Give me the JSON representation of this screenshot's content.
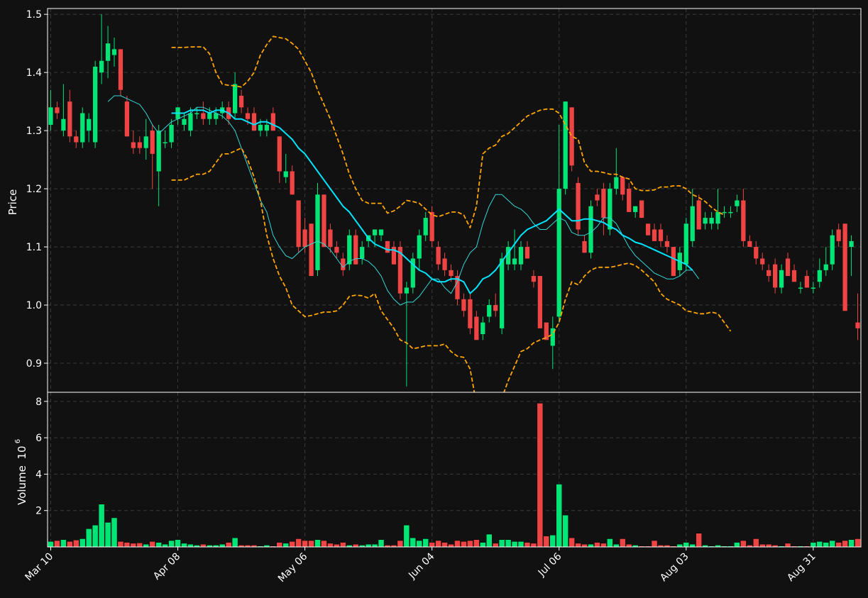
{
  "chart_data": {
    "type": "candlestick",
    "colors": {
      "background": "#111111",
      "up": "#00e676",
      "down": "#ef4444",
      "sma_long": "#00e5ff",
      "sma_short": "#33d6d6",
      "bands": "#ffa500",
      "grid": "#3a3a3a",
      "axes": "#ffffff"
    },
    "grid": true,
    "price_panel": {
      "ylabel": "Price",
      "ylim": [
        0.85,
        1.51
      ],
      "yticks": [
        0.9,
        1.0,
        1.1,
        1.2,
        1.3,
        1.4,
        1.5
      ],
      "ytick_labels": [
        "0.9",
        "1.0",
        "1.1",
        "1.2",
        "1.3",
        "1.4",
        "1.5"
      ]
    },
    "volume_panel": {
      "ylabel": "Volume",
      "scale_label": "10",
      "scale_exponent": "6",
      "ylim": [
        0,
        8.5
      ],
      "yticks": [
        2,
        4,
        6,
        8
      ],
      "ytick_labels": [
        "2",
        "4",
        "6",
        "8"
      ]
    },
    "xticks": [
      {
        "index": 0,
        "label": "Mar 10"
      },
      {
        "index": 20,
        "label": "Apr 08"
      },
      {
        "index": 40,
        "label": "May 06"
      },
      {
        "index": 60,
        "label": "Jun 04"
      },
      {
        "index": 80,
        "label": "Jul 06"
      },
      {
        "index": 100,
        "label": "Aug 03"
      },
      {
        "index": 120,
        "label": "Aug 31"
      }
    ],
    "candles": [
      [
        1.31,
        1.37,
        1.3,
        1.34,
        0.3
      ],
      [
        1.34,
        1.35,
        1.32,
        1.33,
        0.35
      ],
      [
        1.3,
        1.38,
        1.29,
        1.32,
        0.4
      ],
      [
        1.35,
        1.37,
        1.28,
        1.29,
        0.3
      ],
      [
        1.29,
        1.3,
        1.27,
        1.28,
        0.38
      ],
      [
        1.28,
        1.34,
        1.27,
        1.33,
        0.45
      ],
      [
        1.3,
        1.33,
        1.28,
        1.32,
        1.0
      ],
      [
        1.28,
        1.42,
        1.27,
        1.41,
        1.2
      ],
      [
        1.4,
        1.5,
        1.38,
        1.42,
        2.35
      ],
      [
        1.42,
        1.48,
        1.39,
        1.45,
        1.35
      ],
      [
        1.43,
        1.46,
        1.41,
        1.44,
        1.6
      ],
      [
        1.44,
        1.44,
        1.36,
        1.37,
        0.3
      ],
      [
        1.35,
        1.36,
        1.29,
        1.29,
        0.25
      ],
      [
        1.28,
        1.3,
        1.26,
        1.27,
        0.2
      ],
      [
        1.28,
        1.29,
        1.26,
        1.27,
        0.22
      ],
      [
        1.27,
        1.32,
        1.25,
        1.29,
        0.15
      ],
      [
        1.3,
        1.31,
        1.2,
        1.26,
        0.3
      ],
      [
        1.23,
        1.31,
        1.17,
        1.3,
        0.25
      ],
      [
        1.28,
        1.3,
        1.27,
        1.28,
        0.15
      ],
      [
        1.28,
        1.32,
        1.27,
        1.31,
        0.35
      ],
      [
        1.32,
        1.34,
        1.31,
        1.34,
        0.4
      ],
      [
        1.31,
        1.33,
        1.3,
        1.32,
        0.2
      ],
      [
        1.3,
        1.34,
        1.29,
        1.33,
        0.15
      ],
      [
        1.33,
        1.34,
        1.32,
        1.33,
        0.1
      ],
      [
        1.33,
        1.35,
        1.31,
        1.32,
        0.15
      ],
      [
        1.32,
        1.34,
        1.31,
        1.33,
        0.1
      ],
      [
        1.32,
        1.34,
        1.31,
        1.33,
        0.1
      ],
      [
        1.33,
        1.35,
        1.32,
        1.34,
        0.15
      ],
      [
        1.34,
        1.35,
        1.31,
        1.32,
        0.25
      ],
      [
        1.33,
        1.4,
        1.32,
        1.38,
        0.5
      ],
      [
        1.36,
        1.37,
        1.33,
        1.34,
        0.1
      ],
      [
        1.33,
        1.34,
        1.31,
        1.32,
        0.1
      ],
      [
        1.33,
        1.34,
        1.3,
        1.3,
        0.1
      ],
      [
        1.3,
        1.32,
        1.29,
        1.31,
        0.05
      ],
      [
        1.3,
        1.32,
        1.29,
        1.31,
        0.1
      ],
      [
        1.33,
        1.34,
        1.3,
        1.3,
        0.05
      ],
      [
        1.29,
        1.29,
        1.21,
        1.23,
        0.25
      ],
      [
        1.22,
        1.26,
        1.21,
        1.23,
        0.2
      ],
      [
        1.23,
        1.24,
        1.19,
        1.19,
        0.3
      ],
      [
        1.18,
        1.18,
        1.09,
        1.1,
        0.45
      ],
      [
        1.13,
        1.15,
        1.09,
        1.1,
        0.35
      ],
      [
        1.14,
        1.14,
        1.05,
        1.05,
        0.35
      ],
      [
        1.06,
        1.21,
        1.05,
        1.19,
        0.4
      ],
      [
        1.19,
        1.19,
        1.1,
        1.1,
        0.35
      ],
      [
        1.13,
        1.14,
        1.09,
        1.1,
        0.2
      ],
      [
        1.1,
        1.11,
        1.08,
        1.09,
        0.15
      ],
      [
        1.08,
        1.09,
        1.05,
        1.06,
        0.25
      ],
      [
        1.07,
        1.13,
        1.06,
        1.12,
        0.1
      ],
      [
        1.12,
        1.13,
        1.07,
        1.07,
        0.15
      ],
      [
        1.08,
        1.11,
        1.07,
        1.1,
        0.1
      ],
      [
        1.11,
        1.12,
        1.1,
        1.12,
        0.15
      ],
      [
        1.12,
        1.13,
        1.1,
        1.13,
        0.15
      ],
      [
        1.12,
        1.13,
        1.11,
        1.13,
        0.4
      ],
      [
        1.11,
        1.11,
        1.09,
        1.09,
        0.1
      ],
      [
        1.1,
        1.11,
        1.07,
        1.07,
        0.1
      ],
      [
        1.1,
        1.11,
        1.01,
        1.02,
        0.35
      ],
      [
        1.02,
        1.04,
        0.86,
        1.03,
        1.2
      ],
      [
        1.03,
        1.09,
        1.02,
        1.08,
        0.5
      ],
      [
        1.08,
        1.13,
        1.06,
        1.12,
        0.35
      ],
      [
        1.12,
        1.16,
        1.11,
        1.15,
        0.45
      ],
      [
        1.16,
        1.17,
        1.1,
        1.11,
        0.25
      ],
      [
        1.1,
        1.11,
        1.06,
        1.07,
        0.35
      ],
      [
        1.08,
        1.09,
        1.05,
        1.06,
        0.25
      ],
      [
        1.06,
        1.07,
        1.04,
        1.05,
        0.15
      ],
      [
        1.05,
        1.06,
        1.0,
        1.01,
        0.35
      ],
      [
        1.01,
        1.02,
        0.98,
        0.99,
        0.3
      ],
      [
        1.01,
        1.02,
        0.95,
        0.96,
        0.35
      ],
      [
        0.98,
        0.99,
        0.94,
        0.94,
        0.4
      ],
      [
        0.95,
        0.98,
        0.94,
        0.97,
        0.25
      ],
      [
        0.98,
        1.01,
        0.97,
        1.0,
        0.7
      ],
      [
        1.0,
        1.02,
        0.98,
        0.99,
        0.2
      ],
      [
        0.96,
        1.09,
        0.95,
        1.08,
        0.4
      ],
      [
        1.07,
        1.11,
        1.06,
        1.1,
        0.4
      ],
      [
        1.07,
        1.13,
        1.06,
        1.08,
        0.3
      ],
      [
        1.07,
        1.11,
        1.06,
        1.1,
        0.3
      ],
      [
        1.1,
        1.11,
        1.08,
        1.08,
        0.25
      ],
      [
        1.05,
        1.06,
        1.03,
        1.04,
        0.2
      ],
      [
        1.05,
        1.05,
        0.96,
        0.96,
        7.9
      ],
      [
        0.97,
        0.97,
        0.94,
        0.94,
        0.6
      ],
      [
        0.93,
        0.98,
        0.89,
        0.96,
        0.65
      ],
      [
        0.98,
        1.31,
        0.97,
        1.2,
        3.45
      ],
      [
        1.2,
        1.35,
        1.19,
        1.35,
        1.75
      ],
      [
        1.34,
        1.34,
        1.23,
        1.24,
        0.5
      ],
      [
        1.21,
        1.22,
        1.12,
        1.13,
        0.2
      ],
      [
        1.11,
        1.12,
        1.09,
        1.09,
        0.15
      ],
      [
        1.09,
        1.18,
        1.08,
        1.17,
        0.15
      ],
      [
        1.19,
        1.2,
        1.17,
        1.18,
        0.25
      ],
      [
        1.2,
        1.21,
        1.12,
        1.15,
        0.2
      ],
      [
        1.13,
        1.21,
        1.12,
        1.2,
        0.45
      ],
      [
        1.2,
        1.27,
        1.19,
        1.22,
        0.15
      ],
      [
        1.22,
        1.22,
        1.18,
        1.19,
        0.45
      ],
      [
        1.2,
        1.21,
        1.16,
        1.16,
        0.15
      ],
      [
        1.16,
        1.17,
        1.15,
        1.17,
        0.1
      ],
      [
        1.18,
        1.18,
        1.15,
        1.15,
        0.05
      ],
      [
        1.14,
        1.14,
        1.12,
        1.12,
        0.05
      ],
      [
        1.13,
        1.14,
        1.11,
        1.11,
        0.35
      ],
      [
        1.13,
        1.14,
        1.1,
        1.11,
        0.1
      ],
      [
        1.11,
        1.12,
        1.09,
        1.1,
        0.1
      ],
      [
        1.1,
        1.1,
        1.05,
        1.05,
        0.05
      ],
      [
        1.06,
        1.1,
        1.05,
        1.09,
        0.15
      ],
      [
        1.07,
        1.15,
        1.06,
        1.14,
        0.25
      ],
      [
        1.11,
        1.2,
        1.1,
        1.17,
        0.15
      ],
      [
        1.18,
        1.19,
        1.13,
        1.13,
        0.75
      ],
      [
        1.14,
        1.16,
        1.13,
        1.15,
        0.1
      ],
      [
        1.14,
        1.16,
        1.13,
        1.15,
        0.05
      ],
      [
        1.14,
        1.2,
        1.13,
        1.16,
        0.1
      ],
      [
        1.16,
        1.17,
        1.15,
        1.16,
        0.05
      ],
      [
        1.16,
        1.17,
        1.15,
        1.16,
        0.05
      ],
      [
        1.17,
        1.19,
        1.16,
        1.18,
        0.25
      ],
      [
        1.18,
        1.2,
        1.1,
        1.11,
        0.35
      ],
      [
        1.11,
        1.12,
        1.1,
        1.1,
        0.1
      ],
      [
        1.1,
        1.11,
        1.07,
        1.08,
        0.45
      ],
      [
        1.08,
        1.09,
        1.06,
        1.07,
        0.15
      ],
      [
        1.06,
        1.07,
        1.04,
        1.05,
        0.15
      ],
      [
        1.07,
        1.08,
        1.02,
        1.03,
        0.1
      ],
      [
        1.03,
        1.07,
        1.02,
        1.06,
        0.05
      ],
      [
        1.08,
        1.09,
        1.05,
        1.05,
        0.2
      ],
      [
        1.06,
        1.07,
        1.04,
        1.04,
        0.05
      ],
      [
        1.03,
        1.04,
        1.02,
        1.03,
        0.05
      ],
      [
        1.05,
        1.06,
        1.03,
        1.03,
        0.05
      ],
      [
        1.03,
        1.04,
        1.02,
        1.03,
        0.25
      ],
      [
        1.04,
        1.08,
        1.03,
        1.06,
        0.3
      ],
      [
        1.06,
        1.1,
        1.05,
        1.07,
        0.25
      ],
      [
        1.07,
        1.13,
        1.06,
        1.12,
        0.35
      ],
      [
        1.13,
        1.14,
        1.1,
        1.11,
        0.25
      ],
      [
        1.14,
        1.14,
        0.99,
        0.99,
        0.35
      ],
      [
        1.1,
        1.12,
        1.05,
        1.11,
        0.4
      ],
      [
        0.97,
        1.02,
        0.94,
        0.96,
        0.45
      ]
    ],
    "sma_long": {
      "start": 19,
      "values": [
        1.33,
        1.33,
        1.33,
        1.335,
        1.335,
        1.335,
        1.33,
        1.335,
        1.335,
        1.33,
        1.32,
        1.32,
        1.315,
        1.31,
        1.315,
        1.315,
        1.31,
        1.305,
        1.295,
        1.285,
        1.27,
        1.26,
        1.245,
        1.23,
        1.215,
        1.2,
        1.185,
        1.17,
        1.16,
        1.145,
        1.13,
        1.115,
        1.105,
        1.1,
        1.095,
        1.095,
        1.09,
        1.08,
        1.07,
        1.06,
        1.055,
        1.045,
        1.04,
        1.04,
        1.045,
        1.045,
        1.04,
        1.02,
        1.03,
        1.045,
        1.05,
        1.06,
        1.075,
        1.09,
        1.105,
        1.12,
        1.13,
        1.135,
        1.14,
        1.145,
        1.155,
        1.165,
        1.155,
        1.145,
        1.145,
        1.148,
        1.148,
        1.145,
        1.142,
        1.135,
        1.13,
        1.12,
        1.115,
        1.108,
        1.105,
        1.1,
        1.095,
        1.09,
        1.085,
        1.08,
        1.075,
        1.07,
        1.06
      ]
    },
    "sma_short": {
      "start": 9,
      "values": [
        1.35,
        1.36,
        1.36,
        1.355,
        1.35,
        1.345,
        1.33,
        1.31,
        1.295,
        1.305,
        1.315,
        1.32,
        1.325,
        1.33,
        1.34,
        1.34,
        1.335,
        1.33,
        1.325,
        1.315,
        1.3,
        1.27,
        1.24,
        1.21,
        1.18,
        1.16,
        1.12,
        1.1,
        1.085,
        1.08,
        1.09,
        1.1,
        1.105,
        1.11,
        1.105,
        1.095,
        1.08,
        1.065,
        1.075,
        1.08,
        1.08,
        1.075,
        1.065,
        1.05,
        1.025,
        1.01,
        1.0,
        1.005,
        1.005,
        1.015,
        1.03,
        1.045,
        1.045,
        1.03,
        1.02,
        1.04,
        1.07,
        1.09,
        1.1,
        1.14,
        1.17,
        1.19,
        1.19,
        1.18,
        1.17,
        1.165,
        1.155,
        1.14,
        1.13,
        1.13,
        1.14,
        1.15,
        1.145,
        1.125,
        1.12,
        1.12,
        1.125,
        1.135,
        1.15,
        1.15,
        1.14,
        1.12,
        1.1,
        1.085,
        1.075,
        1.065,
        1.055,
        1.05,
        1.045,
        1.045,
        1.05,
        1.06,
        1.06,
        1.045
      ]
    },
    "band_upper": {
      "start": 19,
      "values": [
        1.443,
        1.443,
        1.443,
        1.444,
        1.444,
        1.444,
        1.432,
        1.4,
        1.38,
        1.378,
        1.377,
        1.375,
        1.385,
        1.4,
        1.43,
        1.448,
        1.462,
        1.46,
        1.458,
        1.45,
        1.44,
        1.42,
        1.4,
        1.37,
        1.345,
        1.32,
        1.29,
        1.26,
        1.225,
        1.2,
        1.18,
        1.175,
        1.175,
        1.175,
        1.158,
        1.162,
        1.17,
        1.18,
        1.178,
        1.175,
        1.165,
        1.155,
        1.152,
        1.156,
        1.16,
        1.16,
        1.155,
        1.133,
        1.17,
        1.26,
        1.27,
        1.275,
        1.29,
        1.295,
        1.305,
        1.315,
        1.325,
        1.33,
        1.335,
        1.337,
        1.337,
        1.33,
        1.31,
        1.29,
        1.285,
        1.245,
        1.23,
        1.23,
        1.228,
        1.225,
        1.225,
        1.22,
        1.217,
        1.2,
        1.197,
        1.197,
        1.198,
        1.203,
        1.203,
        1.205,
        1.205,
        1.2,
        1.19,
        1.185,
        1.178,
        1.168,
        1.16,
        1.155
      ]
    },
    "band_lower": {
      "start": 19,
      "values": [
        1.215,
        1.215,
        1.215,
        1.22,
        1.225,
        1.225,
        1.23,
        1.245,
        1.26,
        1.26,
        1.265,
        1.27,
        1.25,
        1.22,
        1.18,
        1.12,
        1.08,
        1.05,
        1.03,
        1.0,
        0.99,
        0.98,
        0.982,
        0.985,
        0.988,
        0.988,
        0.99,
        1.0,
        1.015,
        1.017,
        1.016,
        1.012,
        1.02,
        0.99,
        0.975,
        0.96,
        0.94,
        0.935,
        0.925,
        0.927,
        0.93,
        0.93,
        0.93,
        0.933,
        0.92,
        0.912,
        0.91,
        0.89,
        0.83,
        0.805,
        0.81,
        0.83,
        0.84,
        0.87,
        0.895,
        0.92,
        0.925,
        0.935,
        0.94,
        0.944,
        0.95,
        0.97,
        1.01,
        1.04,
        1.035,
        1.05,
        1.06,
        1.065,
        1.065,
        1.065,
        1.067,
        1.07,
        1.072,
        1.068,
        1.06,
        1.05,
        1.04,
        1.02,
        1.01,
        1.005,
        1.0,
        0.99,
        0.988,
        0.985,
        0.985,
        0.988,
        0.985,
        0.97,
        0.955
      ]
    }
  }
}
